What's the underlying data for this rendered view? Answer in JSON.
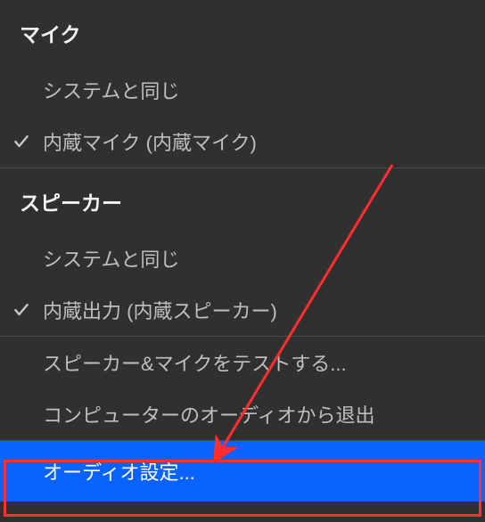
{
  "mic": {
    "header": "マイク",
    "options": [
      {
        "label": "システムと同じ",
        "selected": false
      },
      {
        "label": "内蔵マイク (内蔵マイク)",
        "selected": true
      }
    ]
  },
  "speaker": {
    "header": "スピーカー",
    "options": [
      {
        "label": "システムと同じ",
        "selected": false
      },
      {
        "label": "内蔵出力 (内蔵スピーカー)",
        "selected": true
      }
    ]
  },
  "actions": {
    "test": "スピーカー&マイクをテストする...",
    "leave": "コンピューターのオーディオから退出",
    "settings": "オーディオ設定..."
  },
  "annotation": {
    "highlight_target": "audio-settings-item",
    "color": "#ff2d2d"
  }
}
